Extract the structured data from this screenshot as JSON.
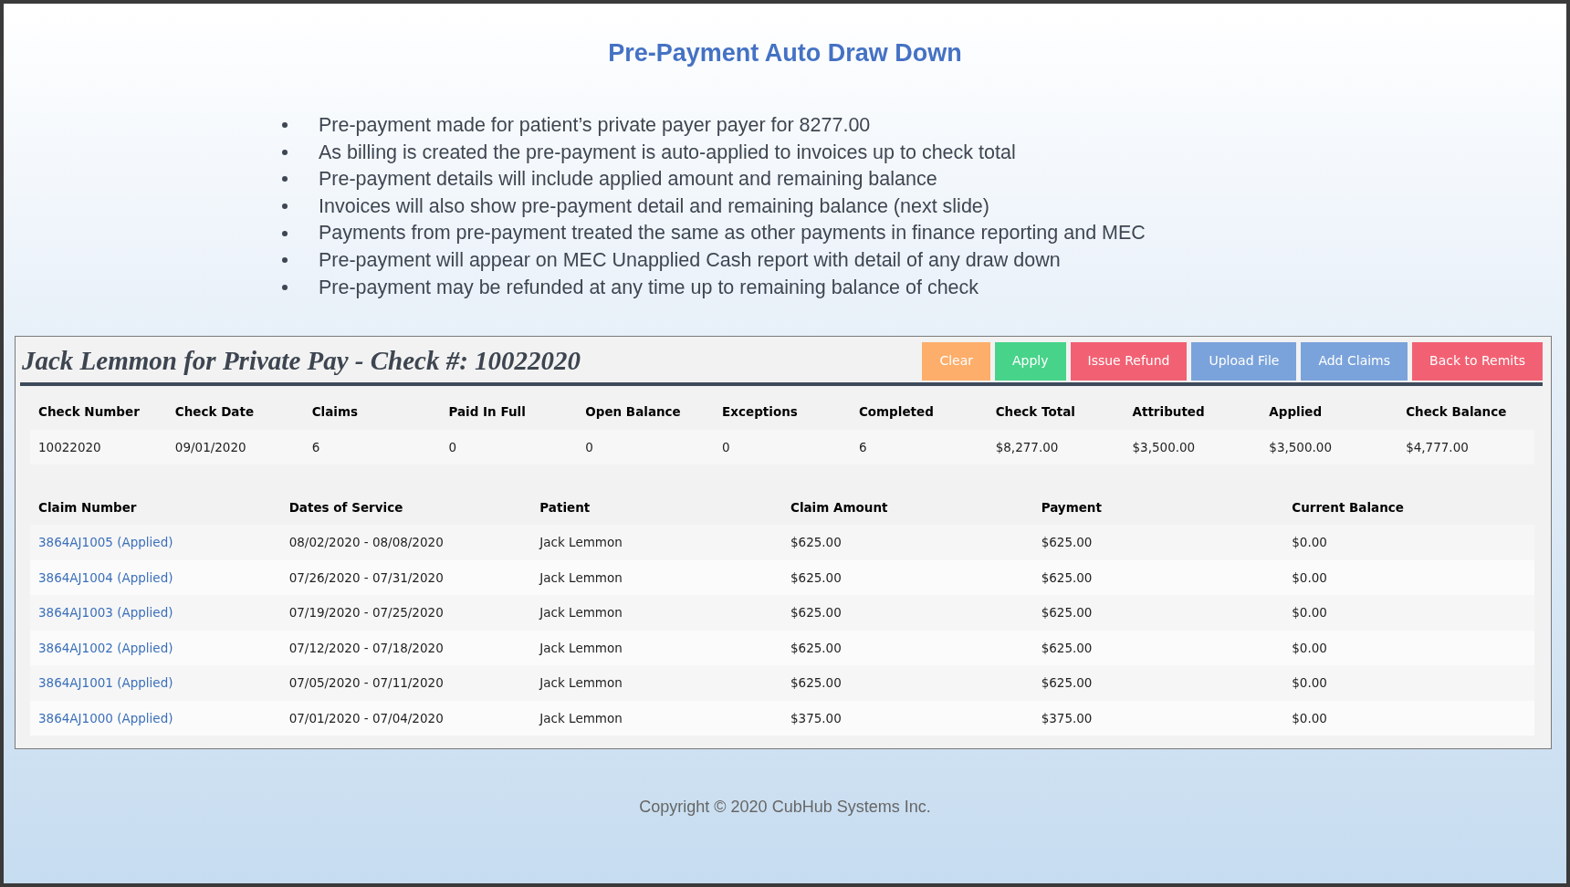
{
  "slide": {
    "title": "Pre-Payment Auto Draw Down",
    "bullets": [
      "Pre-payment made for patient’s private payer payer for 8277.00",
      "As billing is created the pre-payment is auto-applied to invoices up to check total",
      "Pre-payment details will include applied amount and remaining balance",
      "Invoices will also show pre-payment detail and remaining balance (next slide)",
      "Payments from pre-payment treated the same as other payments in finance reporting and MEC",
      "Pre-payment will appear on MEC Unapplied Cash report with detail of any draw down",
      "Pre-payment may be refunded at any time up to remaining balance of check"
    ],
    "footer": "Copyright © 2020 CubHub Systems Inc."
  },
  "panel": {
    "title": "Jack Lemmon for Private Pay - Check #: 10022020",
    "buttons": [
      {
        "label": "Clear",
        "color": "#fdae6b"
      },
      {
        "label": "Apply",
        "color": "#48d38a"
      },
      {
        "label": "Issue Refund",
        "color": "#f26173"
      },
      {
        "label": "Upload File",
        "color": "#7ba3db"
      },
      {
        "label": "Add Claims",
        "color": "#7ba3db"
      },
      {
        "label": "Back to Remits",
        "color": "#f26173"
      }
    ],
    "summary": {
      "columns": [
        "Check Number",
        "Check Date",
        "Claims",
        "Paid In Full",
        "Open Balance",
        "Exceptions",
        "Completed",
        "Check Total",
        "Attributed",
        "Applied",
        "Check Balance"
      ],
      "row": [
        "10022020",
        "09/01/2020",
        "6",
        "0",
        "0",
        "0",
        "6",
        "$8,277.00",
        "$3,500.00",
        "$3,500.00",
        "$4,777.00"
      ]
    },
    "claims": {
      "columns": [
        "Claim Number",
        "Dates of Service",
        "Patient",
        "Claim Amount",
        "Payment",
        "Current Balance"
      ],
      "rows": [
        [
          "3864AJ1005 (Applied)",
          "08/02/2020 - 08/08/2020",
          "Jack Lemmon",
          "$625.00",
          "$625.00",
          "$0.00"
        ],
        [
          "3864AJ1004 (Applied)",
          "07/26/2020 - 07/31/2020",
          "Jack Lemmon",
          "$625.00",
          "$625.00",
          "$0.00"
        ],
        [
          "3864AJ1003 (Applied)",
          "07/19/2020 - 07/25/2020",
          "Jack Lemmon",
          "$625.00",
          "$625.00",
          "$0.00"
        ],
        [
          "3864AJ1002 (Applied)",
          "07/12/2020 - 07/18/2020",
          "Jack Lemmon",
          "$625.00",
          "$625.00",
          "$0.00"
        ],
        [
          "3864AJ1001 (Applied)",
          "07/05/2020 - 07/11/2020",
          "Jack Lemmon",
          "$625.00",
          "$625.00",
          "$0.00"
        ],
        [
          "3864AJ1000 (Applied)",
          "07/01/2020 - 07/04/2020",
          "Jack Lemmon",
          "$375.00",
          "$375.00",
          "$0.00"
        ]
      ]
    }
  }
}
